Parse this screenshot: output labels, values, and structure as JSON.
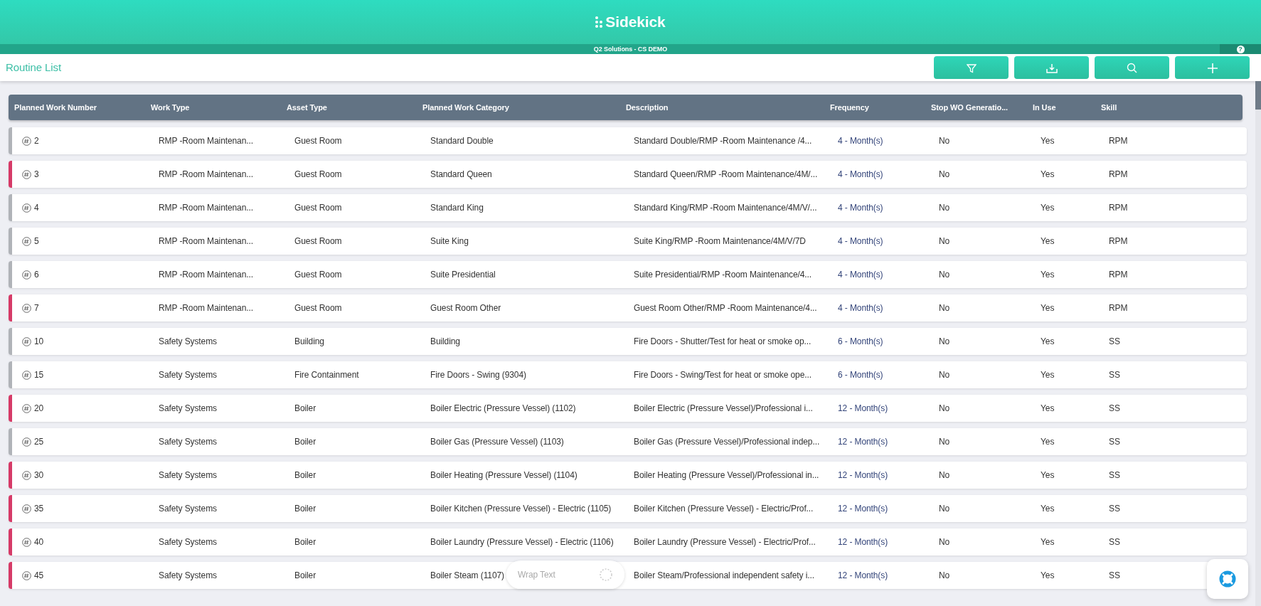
{
  "app": {
    "logo": "Sidekick",
    "site": "Q2 Solutions - CS DEMO",
    "help": "?"
  },
  "page": {
    "title": "Routine List"
  },
  "table": {
    "columns": [
      "Planned Work Number",
      "Work Type",
      "Asset Type",
      "Planned Work Category",
      "Description",
      "Frequency",
      "Stop WO Generatio...",
      "In Use",
      "Skill"
    ],
    "rows": [
      {
        "color": "#b0b3b8",
        "cells": [
          "2",
          "RMP -Room Maintenan...",
          "Guest Room",
          "Standard Double",
          "Standard Double/RMP -Room Maintenance /4...",
          "4 - Month(s)",
          "No",
          "Yes",
          "RPM"
        ]
      },
      {
        "color": "#d63a67",
        "cells": [
          "3",
          "RMP -Room Maintenan...",
          "Guest Room",
          "Standard Queen",
          "Standard Queen/RMP -Room Maintenance/4M/...",
          "4 - Month(s)",
          "No",
          "Yes",
          "RPM"
        ]
      },
      {
        "color": "#b0b3b8",
        "cells": [
          "4",
          "RMP -Room Maintenan...",
          "Guest Room",
          "Standard King",
          "Standard King/RMP -Room Maintenance/4M/V/...",
          "4 - Month(s)",
          "No",
          "Yes",
          "RPM"
        ]
      },
      {
        "color": "#b0b3b8",
        "cells": [
          "5",
          "RMP -Room Maintenan...",
          "Guest Room",
          "Suite King",
          "Suite King/RMP -Room Maintenance/4M/V/7D",
          "4 - Month(s)",
          "No",
          "Yes",
          "RPM"
        ]
      },
      {
        "color": "#b0b3b8",
        "cells": [
          "6",
          "RMP -Room Maintenan...",
          "Guest Room",
          "Suite Presidential",
          "Suite Presidential/RMP -Room Maintenance/4...",
          "4 - Month(s)",
          "No",
          "Yes",
          "RPM"
        ]
      },
      {
        "color": "#d63a67",
        "cells": [
          "7",
          "RMP -Room Maintenan...",
          "Guest Room",
          "Guest Room Other",
          "Guest Room Other/RMP -Room Maintenance/4...",
          "4 - Month(s)",
          "No",
          "Yes",
          "RPM"
        ]
      },
      {
        "color": "#b0b3b8",
        "cells": [
          "10",
          "Safety Systems",
          "Building",
          "Building",
          "Fire Doors - Shutter/Test for heat or smoke op...",
          "6 - Month(s)",
          "No",
          "Yes",
          "SS"
        ]
      },
      {
        "color": "#b0b3b8",
        "cells": [
          "15",
          "Safety Systems",
          "Fire Containment",
          "Fire Doors - Swing (9304)",
          "Fire Doors - Swing/Test for heat or smoke ope...",
          "6 - Month(s)",
          "No",
          "Yes",
          "SS"
        ]
      },
      {
        "color": "#d63a67",
        "cells": [
          "20",
          "Safety Systems",
          "Boiler",
          "Boiler Electric (Pressure Vessel) (1102)",
          "Boiler Electric (Pressure Vessel)/Professional i...",
          "12 - Month(s)",
          "No",
          "Yes",
          "SS"
        ]
      },
      {
        "color": "#b0b3b8",
        "cells": [
          "25",
          "Safety Systems",
          "Boiler",
          "Boiler Gas (Pressure Vessel) (1103)",
          "Boiler Gas (Pressure Vessel)/Professional indep...",
          "12 - Month(s)",
          "No",
          "Yes",
          "SS"
        ]
      },
      {
        "color": "#d63a67",
        "cells": [
          "30",
          "Safety Systems",
          "Boiler",
          "Boiler Heating (Pressure Vessel) (1104)",
          "Boiler Heating (Pressure Vessel)/Professional in...",
          "12 - Month(s)",
          "No",
          "Yes",
          "SS"
        ]
      },
      {
        "color": "#d63a67",
        "cells": [
          "35",
          "Safety Systems",
          "Boiler",
          "Boiler Kitchen (Pressure Vessel) - Electric (1105)",
          "Boiler Kitchen (Pressure Vessel) - Electric/Prof...",
          "12 - Month(s)",
          "No",
          "Yes",
          "SS"
        ]
      },
      {
        "color": "#d63a67",
        "cells": [
          "40",
          "Safety Systems",
          "Boiler",
          "Boiler Laundry (Pressure Vessel) - Electric (1106)",
          "Boiler Laundry (Pressure Vessel) - Electric/Prof...",
          "12 - Month(s)",
          "No",
          "Yes",
          "SS"
        ]
      },
      {
        "color": "#d63a67",
        "cells": [
          "45",
          "Safety Systems",
          "Boiler",
          "Boiler Steam (1107)",
          "Boiler Steam/Professional independent safety i...",
          "12 - Month(s)",
          "No",
          "Yes",
          "SS"
        ]
      }
    ]
  },
  "wrap_toggle": {
    "label": "Wrap Text"
  }
}
